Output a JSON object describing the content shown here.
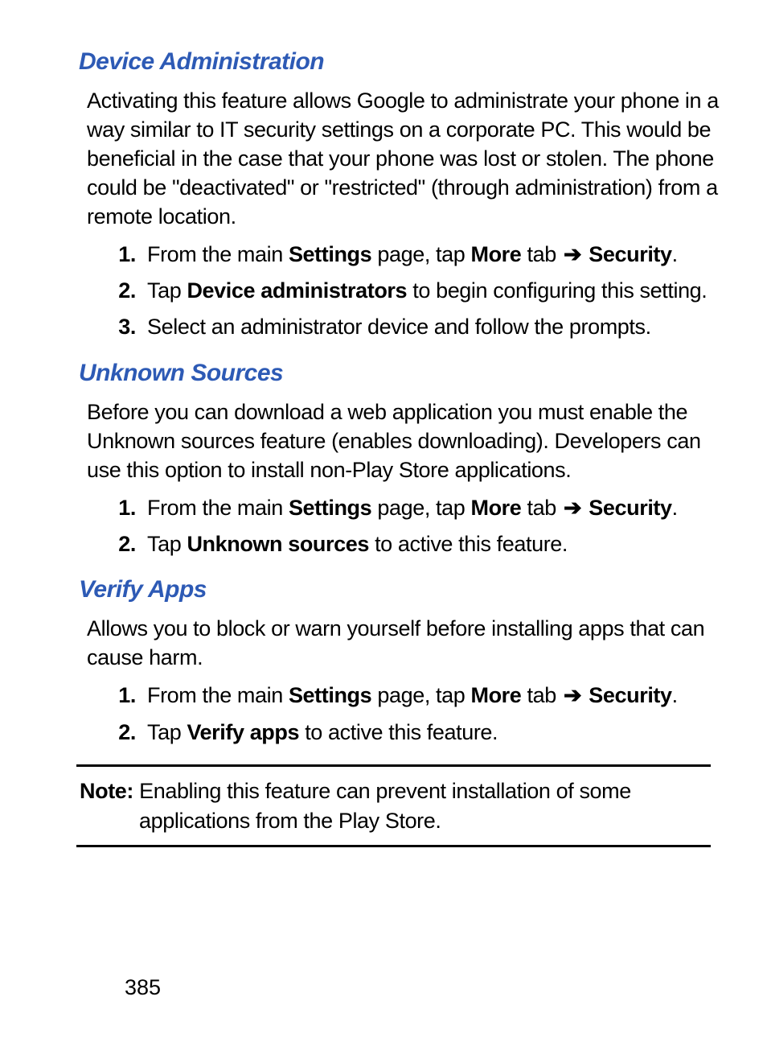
{
  "sections": [
    {
      "heading": "Device Administration",
      "body": "Activating this feature allows Google to administrate your phone in a way similar to IT security settings on a corporate PC. This would be beneficial in the case that your phone was lost or stolen. The phone could be \"deactivated\" or \"restricted\" (through administration) from a remote location.",
      "steps": {
        "num1": "1.",
        "num2": "2.",
        "num3": "3.",
        "s1_t1": "From the main ",
        "s1_b1": "Settings",
        "s1_t2": " page, tap ",
        "s1_b2": "More",
        "s1_t3": " tab ",
        "s1_arrow": "➔",
        "s1_b3": " Security",
        "s1_t4": ".",
        "s2_t1": "Tap ",
        "s2_b1": "Device administrators",
        "s2_t2": " to begin configuring this setting.",
        "s3_t1": "Select an administrator device and follow the prompts."
      }
    },
    {
      "heading": "Unknown Sources",
      "body": "Before you can download a web application you must enable the Unknown sources feature (enables downloading). Developers can use this option to install non-Play Store applications.",
      "steps": {
        "num1": "1.",
        "num2": "2.",
        "s1_t1": "From the main ",
        "s1_b1": "Settings",
        "s1_t2": " page, tap ",
        "s1_b2": "More",
        "s1_t3": " tab ",
        "s1_arrow": "➔",
        "s1_b3": " Security",
        "s1_t4": ".",
        "s2_t1": "Tap ",
        "s2_b1": "Unknown sources",
        "s2_t2": " to active this feature."
      }
    },
    {
      "heading": "Verify Apps",
      "body": "Allows you to block or warn yourself before installing apps that can cause harm.",
      "steps": {
        "num1": "1.",
        "num2": "2.",
        "s1_t1": "From the main ",
        "s1_b1": "Settings",
        "s1_t2": " page, tap ",
        "s1_b2": "More",
        "s1_t3": " tab ",
        "s1_arrow": "➔",
        "s1_b3": " Security",
        "s1_t4": ".",
        "s2_t1": "Tap ",
        "s2_b1": "Verify apps",
        "s2_t2": " to active this feature."
      }
    }
  ],
  "note": {
    "label": "Note:",
    "line1": " Enabling this feature can prevent installation of some",
    "line2": "applications from the Play Store."
  },
  "page_number": "385"
}
